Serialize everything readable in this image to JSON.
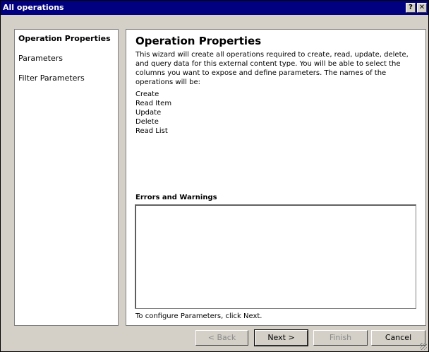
{
  "window": {
    "title": "All operations",
    "help_glyph": "?",
    "close_glyph": "✕"
  },
  "nav": {
    "items": [
      {
        "label": "Operation Properties",
        "active": true
      },
      {
        "label": "Parameters",
        "active": false
      },
      {
        "label": "Filter Parameters",
        "active": false
      }
    ]
  },
  "content": {
    "heading": "Operation Properties",
    "description_lines": [
      "This wizard will create all operations required to create, read, update, delete,",
      "and query data for this external content type. You will be able to select the",
      "columns you want to expose and define parameters. The names of the",
      "operations will be:"
    ],
    "operations": [
      "Create",
      "Read Item",
      "Update",
      "Delete",
      "Read List"
    ],
    "errors_label": "Errors and Warnings",
    "hint": "To configure Parameters, click Next."
  },
  "buttons": {
    "back": "< Back",
    "next": "Next >",
    "finish": "Finish",
    "cancel": "Cancel"
  }
}
